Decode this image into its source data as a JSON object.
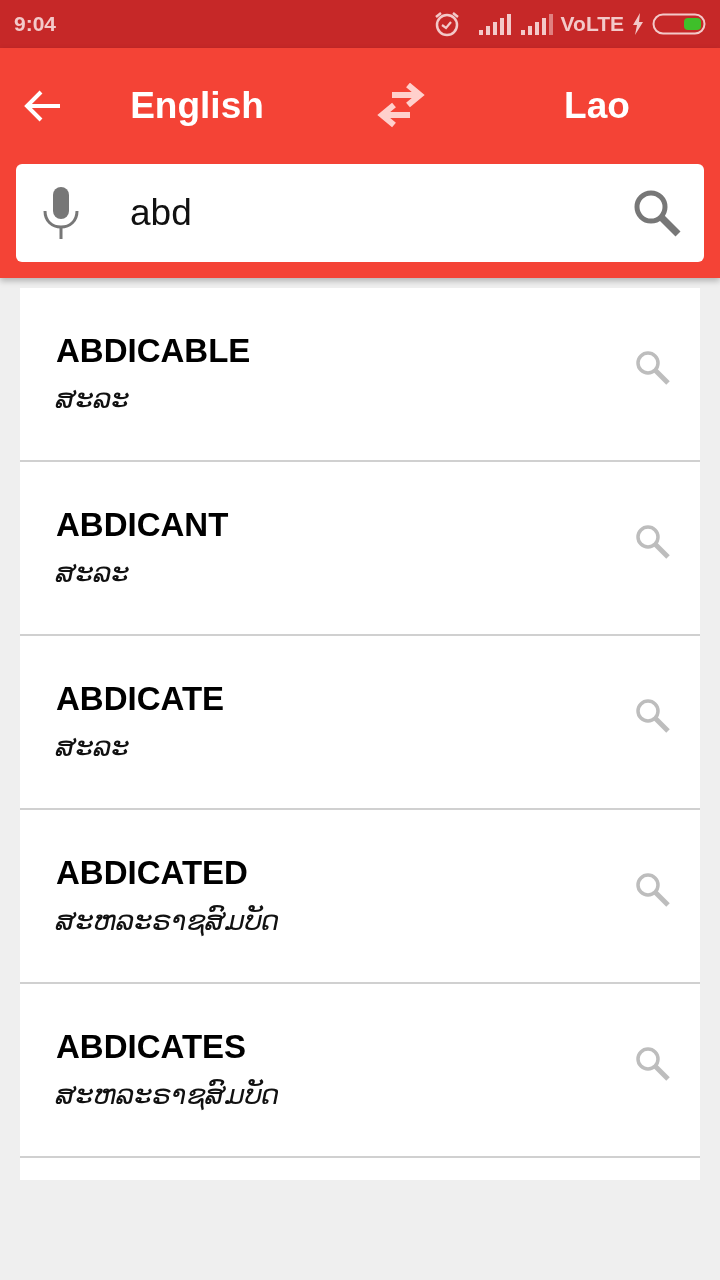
{
  "status_bar": {
    "time": "9:04",
    "network": "VoLTE"
  },
  "toolbar": {
    "source_language": "English",
    "target_language": "Lao"
  },
  "search": {
    "value": "abd"
  },
  "results": [
    {
      "word": "ABDICABLE",
      "translation": "ສະລະ"
    },
    {
      "word": "ABDICANT",
      "translation": "ສະລະ"
    },
    {
      "word": "ABDICATE",
      "translation": "ສະລະ"
    },
    {
      "word": "ABDICATED",
      "translation": "ສະຫລະຣາຊສົມບັດ"
    },
    {
      "word": "ABDICATES",
      "translation": "ສະຫລະຣາຊສົມບັດ"
    }
  ]
}
